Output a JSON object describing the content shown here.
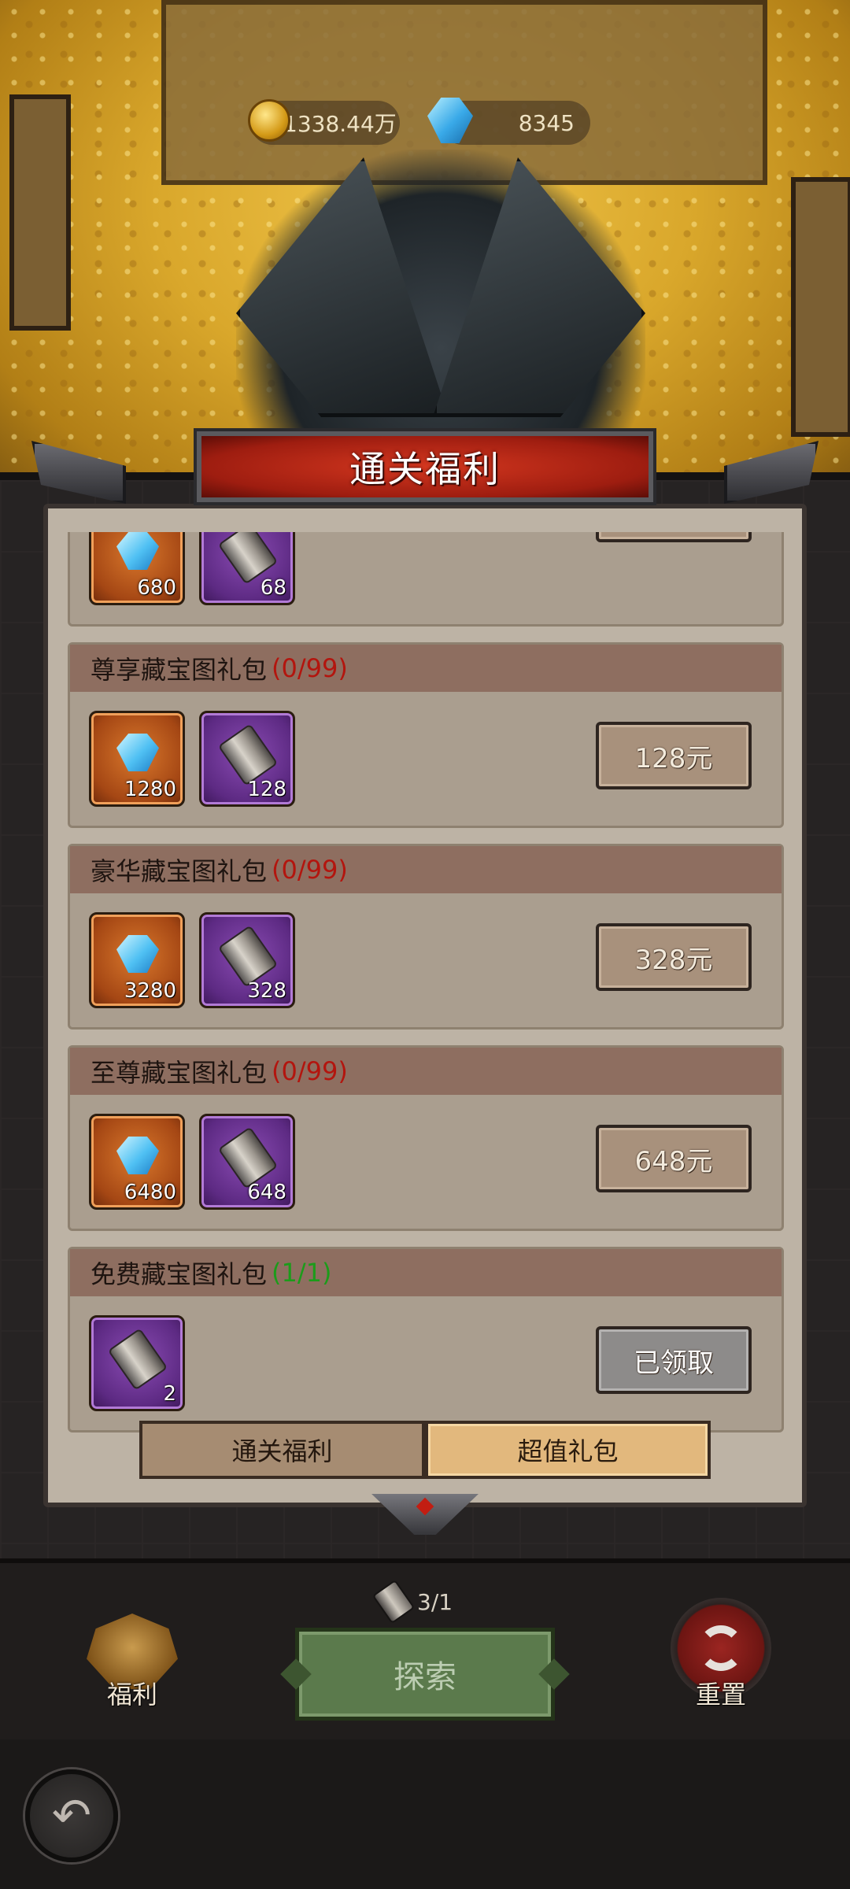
{
  "currency": {
    "gold": "1338.44万",
    "gems": "8345"
  },
  "panel": {
    "title": "通关福利"
  },
  "partial_pack": {
    "items": [
      {
        "type": "gem",
        "qty": "680"
      },
      {
        "type": "scroll",
        "qty": "68"
      }
    ]
  },
  "packs": [
    {
      "name": "尊享藏宝图礼包",
      "count": "(0/99)",
      "items": [
        {
          "type": "gem",
          "qty": "1280"
        },
        {
          "type": "scroll",
          "qty": "128"
        }
      ],
      "button": "128元"
    },
    {
      "name": "豪华藏宝图礼包",
      "count": "(0/99)",
      "items": [
        {
          "type": "gem",
          "qty": "3280"
        },
        {
          "type": "scroll",
          "qty": "328"
        }
      ],
      "button": "328元"
    },
    {
      "name": "至尊藏宝图礼包",
      "count": "(0/99)",
      "items": [
        {
          "type": "gem",
          "qty": "6480"
        },
        {
          "type": "scroll",
          "qty": "648"
        }
      ],
      "button": "648元"
    },
    {
      "name": "免费藏宝图礼包",
      "count": "(1/1)",
      "items": [
        {
          "type": "scroll",
          "qty": "2"
        }
      ],
      "button": "已领取"
    }
  ],
  "tabs": {
    "clear_rewards": "通关福利",
    "value_packs": "超值礼包",
    "active": "value_packs"
  },
  "bottom": {
    "welfare_label": "福利",
    "map_count": "3/1",
    "explore_label": "探索",
    "reset_label": "重置"
  },
  "colors": {
    "count_unclaimed": "#b3150e",
    "count_claimed": "#1c9c1a",
    "title_banner": "#9e1d10"
  }
}
